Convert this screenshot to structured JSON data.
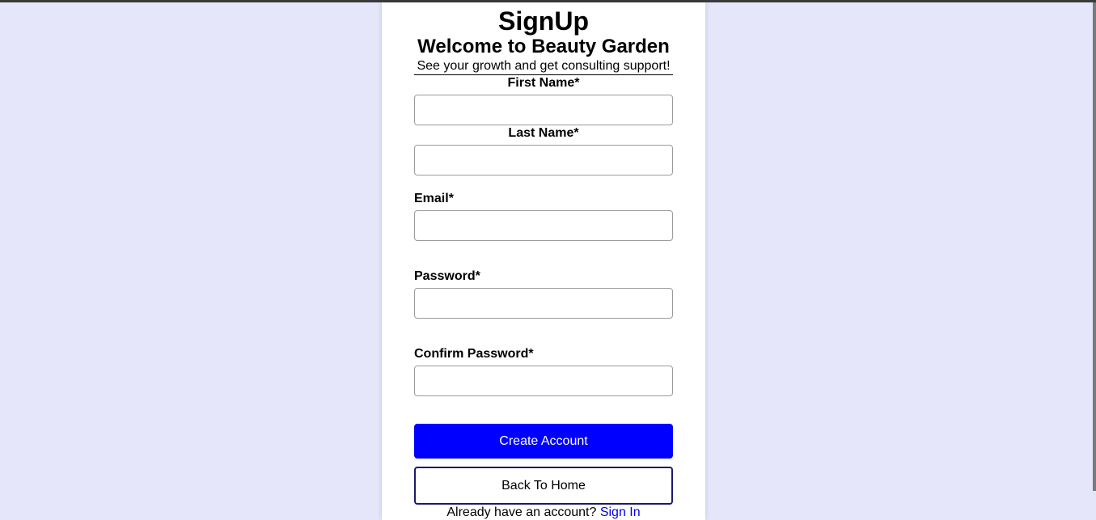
{
  "page": {
    "title": "SignUp",
    "welcome": "Welcome to Beauty Garden",
    "subtitle": "See your growth and get consulting support!"
  },
  "form": {
    "first_name_label": "First Name*",
    "last_name_label": "Last Name*",
    "email_label": "Email*",
    "password_label": "Password*",
    "confirm_password_label": "Confirm Password*",
    "first_name_value": "",
    "last_name_value": "",
    "email_value": "",
    "password_value": "",
    "confirm_password_value": ""
  },
  "actions": {
    "create_account_label": "Create Account",
    "back_home_label": "Back To Home"
  },
  "footer": {
    "prompt": "Already have an account?",
    "sign_in_link": "Sign In"
  },
  "colors": {
    "background": "#e6e6fa",
    "primary_button": "#0000ff",
    "link": "#0000ee"
  }
}
